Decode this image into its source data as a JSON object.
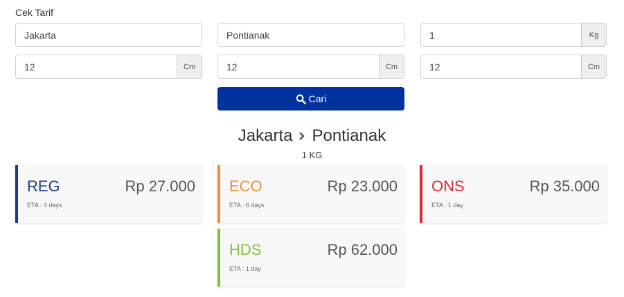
{
  "title": "Cek Tarif",
  "inputs": {
    "origin": "Jakarta",
    "destination": "Pontianak",
    "weight": "1",
    "weight_unit": "Kg",
    "length": "12",
    "width": "12",
    "height": "12",
    "dim_unit": "Cm"
  },
  "search_button": {
    "label": "Cari",
    "icon": "search-icon"
  },
  "result": {
    "origin": "Jakarta",
    "destination": "Pontianak",
    "weight_label": "1 KG"
  },
  "services": [
    {
      "code": "REG",
      "price": "Rp 27.000",
      "eta": "ETA : 4 days",
      "color": "#1f3a8a"
    },
    {
      "code": "ECO",
      "price": "Rp 23.000",
      "eta": "ETA : 6 days",
      "color": "#e8913c"
    },
    {
      "code": "ONS",
      "price": "Rp 35.000",
      "eta": "ETA : 1 day",
      "color": "#d62b35"
    },
    {
      "code": "HDS",
      "price": "Rp 62.000",
      "eta": "ETA : 1 day",
      "color": "#7fbf3f"
    }
  ]
}
